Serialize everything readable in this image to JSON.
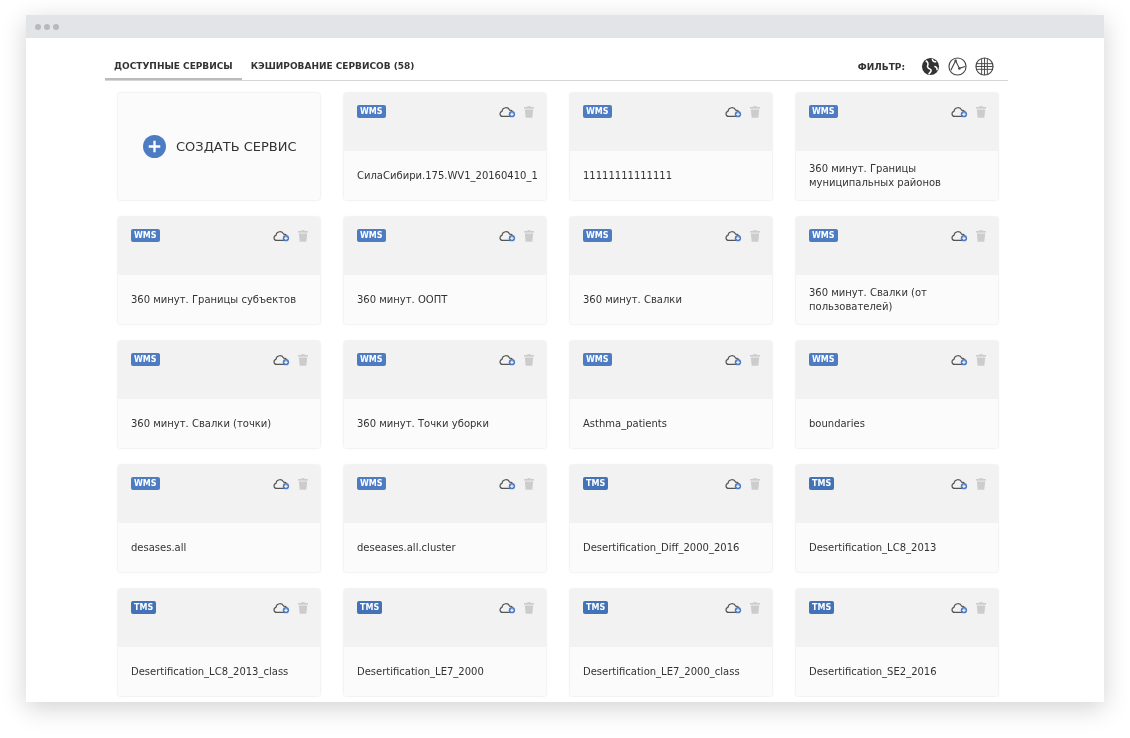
{
  "tabs": [
    {
      "label": "ДОСТУПНЫЕ СЕРВИСЫ",
      "selected": true
    },
    {
      "label": "КЭШИРОВАНИЕ СЕРВИСОВ (58)",
      "selected": false
    }
  ],
  "filter": {
    "label": "ФИЛЬТР:",
    "options": [
      {
        "kind": "globe"
      },
      {
        "kind": "vector"
      },
      {
        "kind": "grid"
      }
    ]
  },
  "create_card": {
    "label": "СОЗДАТЬ СЕРВИС"
  },
  "services": [
    {
      "type": "WMS",
      "title": "СилаСибири.175.WV1_20160410_1"
    },
    {
      "type": "WMS",
      "title": "11111111111111"
    },
    {
      "type": "WMS",
      "title": "360 минут. Границы муниципальных районов"
    },
    {
      "type": "WMS",
      "title": "360 минут. Границы субъектов"
    },
    {
      "type": "WMS",
      "title": "360 минут. ООПТ"
    },
    {
      "type": "WMS",
      "title": "360 минут. Свалки"
    },
    {
      "type": "WMS",
      "title": "360 минут. Свалки (от пользователей)"
    },
    {
      "type": "WMS",
      "title": "360 минут. Свалки (точки)"
    },
    {
      "type": "WMS",
      "title": "360 минут. Точки уборки"
    },
    {
      "type": "WMS",
      "title": "Asthma_patients"
    },
    {
      "type": "WMS",
      "title": "boundaries"
    },
    {
      "type": "WMS",
      "title": "desases.all"
    },
    {
      "type": "WMS",
      "title": "deseases.all.cluster"
    },
    {
      "type": "TMS",
      "title": "Desertification_Diff_2000_2016"
    },
    {
      "type": "TMS",
      "title": "Desertification_LC8_2013"
    },
    {
      "type": "TMS",
      "title": "Desertification_LC8_2013_class"
    },
    {
      "type": "TMS",
      "title": "Desertification_LE7_2000"
    },
    {
      "type": "TMS",
      "title": "Desertification_LE7_2000_class"
    },
    {
      "type": "TMS",
      "title": "Desertification_SE2_2016"
    }
  ]
}
